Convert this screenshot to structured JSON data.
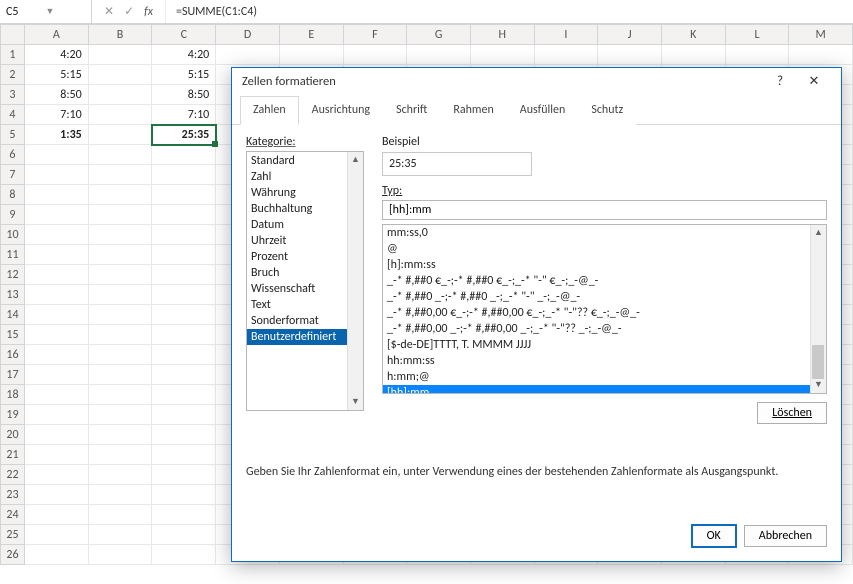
{
  "formula_bar": {
    "cell_ref": "C5",
    "formula": "=SUMME(C1:C4)"
  },
  "columns": [
    "A",
    "B",
    "C",
    "D",
    "E",
    "F",
    "G",
    "H",
    "I",
    "J",
    "K",
    "L",
    "M"
  ],
  "row_numbers": [
    1,
    2,
    3,
    4,
    5,
    6,
    7,
    8,
    9,
    10,
    11,
    12,
    13,
    14,
    15,
    16,
    17,
    18,
    19,
    20,
    21,
    22,
    23,
    24,
    25,
    26
  ],
  "cells": {
    "A1": "4:20",
    "A2": "5:15",
    "A3": "8:50",
    "A4": "7:10",
    "A5": "1:35",
    "C1": "4:20",
    "C2": "5:15",
    "C3": "8:50",
    "C4": "7:10",
    "C5": "25:35"
  },
  "dialog": {
    "title": "Zellen formatieren",
    "tabs": [
      "Zahlen",
      "Ausrichtung",
      "Schrift",
      "Rahmen",
      "Ausfüllen",
      "Schutz"
    ],
    "active_tab": "Zahlen",
    "category_label": "Kategorie:",
    "categories": [
      "Standard",
      "Zahl",
      "Währung",
      "Buchhaltung",
      "Datum",
      "Uhrzeit",
      "Prozent",
      "Bruch",
      "Wissenschaft",
      "Text",
      "Sonderformat",
      "Benutzerdefiniert"
    ],
    "selected_category": "Benutzerdefiniert",
    "example_label": "Beispiel",
    "example_value": "25:35",
    "type_label": "Typ:",
    "type_value": "[hh]:mm",
    "format_rows": [
      "mm:ss,0",
      "@",
      "[h]:mm:ss",
      "_-* #,##0 €_-;-* #,##0 €_-;_-* \"-\" €_-;_-@_-",
      "_-* #,##0 _-;-* #,##0 _-;_-* \"-\" _-;_-@_-",
      "_-* #,##0,00 €_-;-* #,##0,00 €_-;_-* \"-\"?? €_-;_-@_-",
      "_-* #,##0,00 _-;-* #,##0,00 _-;_-* \"-\"?? _-;_-@_-",
      "[$-de-DE]TTTT, T. MMMM JJJJ",
      "hh:mm:ss",
      "h:mm;@",
      "[hh]:mm"
    ],
    "selected_format": "[hh]:mm",
    "delete_label": "Löschen",
    "hint": "Geben Sie Ihr Zahlenformat ein, unter Verwendung eines der bestehenden Zahlenformate als Ausgangspunkt.",
    "ok_label": "OK",
    "cancel_label": "Abbrechen"
  }
}
